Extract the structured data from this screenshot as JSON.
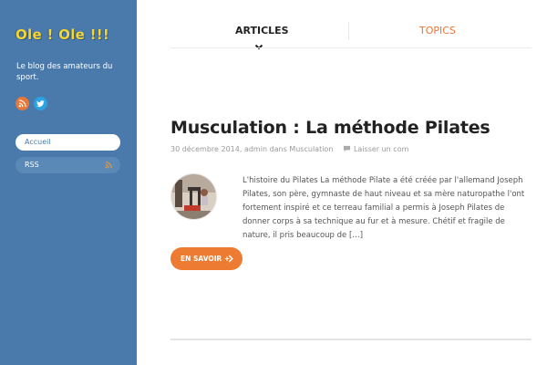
{
  "sidebar": {
    "site_title": "Ole ! Ole !!!",
    "tagline": "Le blog des amateurs du sport.",
    "social": [
      "rss-icon",
      "twitter-icon"
    ],
    "nav": [
      {
        "label": "Accueil"
      },
      {
        "label": "RSS"
      }
    ]
  },
  "tabs": {
    "articles": "ARTICLES",
    "topics": "TOPICS"
  },
  "post": {
    "title": "Musculation : La méthode Pilates",
    "date": "30 décembre 2014,",
    "author_prefix": "admin dans",
    "category": "Musculation",
    "comments": "Laisser un com",
    "excerpt": "L'histoire du Pilates La méthode Pilate a été créée par l'allemand Joseph Pilates, son père, gymnaste de haut niveau et sa mère naturopathe l'ont fortement inspiré et ce terreau familial a permis à Joseph Pilates de donner corps à sa technique au fur et à mesure. Chétif et fragile de nature, il pris beaucoup de […]",
    "read_more": "EN SAVOIR +"
  },
  "colors": {
    "sidebar_bg": "#4a7aab",
    "accent": "#ed7b31",
    "logo": "#f7d531"
  }
}
